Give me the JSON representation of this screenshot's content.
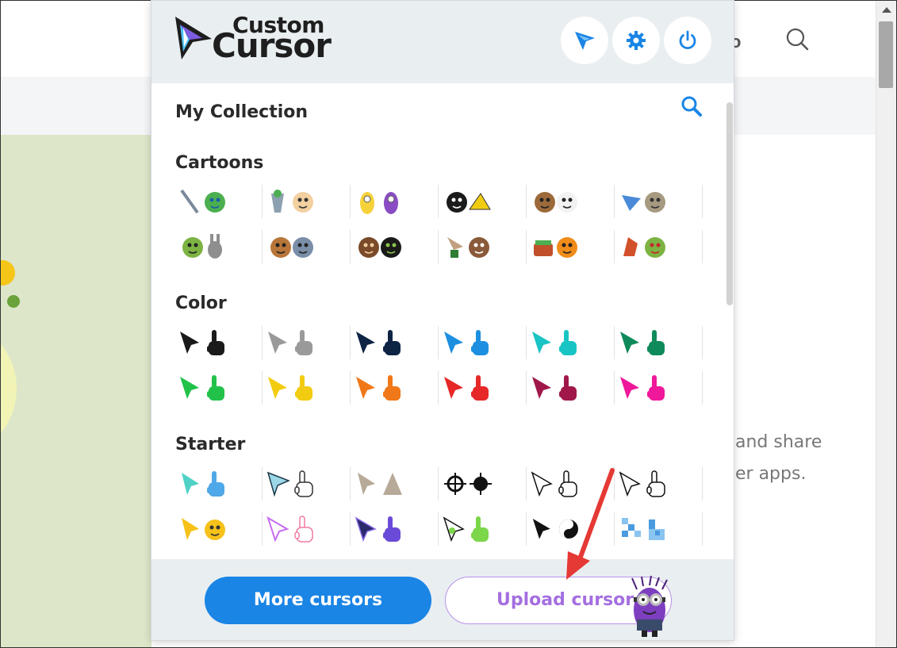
{
  "app": {
    "logo_line1": "Custom",
    "logo_line2": "Cursor",
    "header_buttons": [
      {
        "name": "cursor-mode-icon"
      },
      {
        "name": "settings-gear-icon"
      },
      {
        "name": "power-icon"
      }
    ]
  },
  "background_page": {
    "text_line1": "and share",
    "text_line2": "er apps.",
    "partial_icon_text": "o"
  },
  "sections": {
    "my_collection": "My Collection",
    "cartoons": "Cartoons",
    "color": "Color",
    "starter": "Starter"
  },
  "cartoon_packs": [
    "Ninja Turtle Leonardo",
    "Popeye",
    "Minions",
    "Felix the Cat",
    "We Bare Bears",
    "Regular Show",
    "Shrek & Donkey",
    "Tom and Jerry",
    "How to Train Your Dragon",
    "Ben 10",
    "Garfield",
    "The Grinch"
  ],
  "color_packs": [
    {
      "color": "#1a1a1a"
    },
    {
      "color": "#9a9a9a"
    },
    {
      "color": "#0d2445"
    },
    {
      "color": "#1d8fe0"
    },
    {
      "color": "#19c4c4"
    },
    {
      "color": "#0f8a5a"
    },
    {
      "color": "#22c24a"
    },
    {
      "color": "#f2cc10"
    },
    {
      "color": "#f07818"
    },
    {
      "color": "#e62828"
    },
    {
      "color": "#a0184a"
    },
    {
      "color": "#f0189a"
    }
  ],
  "starter_packs": [
    "Cyan arrow",
    "Paper plane",
    "Stone arrow",
    "Crosshair",
    "Classic white",
    "Rock hand",
    "Smiley",
    "Rainbow outline",
    "Purple arrow",
    "Green arrow",
    "Yin yang",
    "Pixel blue"
  ],
  "footer": {
    "more_label": "More cursors",
    "upload_label": "Upload cursor"
  },
  "colors": {
    "accent_blue": "#1a85e5",
    "upload_purple": "#a46fe0",
    "annotation_red": "#e53935"
  }
}
